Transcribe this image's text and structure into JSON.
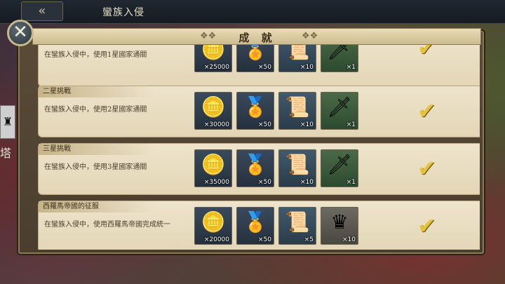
{
  "top_bar": {
    "back_icon": "double-chevron-left-icon",
    "back_glyph": "«",
    "title": "蠻族入侵"
  },
  "side": {
    "emblem_glyph": "♜",
    "text": "塔"
  },
  "panel": {
    "title": "成 就",
    "close_glyph": "✕"
  },
  "achievements": [
    {
      "label": "",
      "desc": "在蠻族入侵中，使用1星國家通關",
      "rewards": [
        {
          "icon": "gold-coins-icon",
          "glyph": "🪙",
          "qty": "×25000"
        },
        {
          "icon": "medal-badge-icon",
          "glyph": "🏅",
          "qty": "×50"
        },
        {
          "icon": "scroll-icon",
          "glyph": "📜",
          "qty": "×10"
        },
        {
          "icon": "sword-icon",
          "glyph": "🗡",
          "qty": "×1"
        }
      ],
      "completed": true
    },
    {
      "label": "二星挑戰",
      "desc": "在蠻族入侵中，使用2星國家通關",
      "rewards": [
        {
          "icon": "gold-coins-icon",
          "glyph": "🪙",
          "qty": "×30000"
        },
        {
          "icon": "medal-badge-icon",
          "glyph": "🏅",
          "qty": "×50"
        },
        {
          "icon": "scroll-icon",
          "glyph": "📜",
          "qty": "×10"
        },
        {
          "icon": "sword-icon",
          "glyph": "🗡",
          "qty": "×1"
        }
      ],
      "completed": true
    },
    {
      "label": "三星挑戰",
      "desc": "在蠻族入侵中，使用3星國家通關",
      "rewards": [
        {
          "icon": "gold-coins-icon",
          "glyph": "🪙",
          "qty": "×35000"
        },
        {
          "icon": "medal-badge-icon",
          "glyph": "🏅",
          "qty": "×50"
        },
        {
          "icon": "scroll-icon",
          "glyph": "📜",
          "qty": "×10"
        },
        {
          "icon": "sword-icon",
          "glyph": "🗡",
          "qty": "×1"
        }
      ],
      "completed": true
    },
    {
      "label": "西羅馬帝國的征服",
      "desc": "在蠻族入侵中，使用西羅馬帝國完成統一",
      "rewards": [
        {
          "icon": "gold-coins-icon",
          "glyph": "🪙",
          "qty": "×20000"
        },
        {
          "icon": "medal-badge-icon",
          "glyph": "🏅",
          "qty": "×50"
        },
        {
          "icon": "blueprint-scroll-icon",
          "glyph": "📜",
          "qty": "×5"
        },
        {
          "icon": "castle-crown-icon",
          "glyph": "♛",
          "qty": "×10"
        }
      ],
      "completed": true
    }
  ],
  "check_glyph": "✔"
}
